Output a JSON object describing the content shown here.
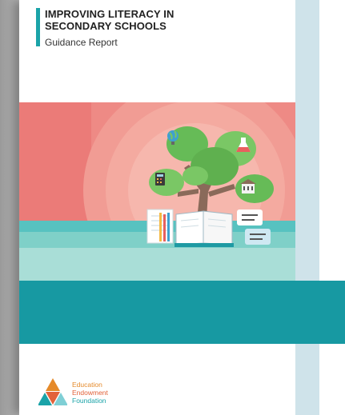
{
  "report": {
    "title_line1": "IMPROVING LITERACY IN",
    "title_line2": "SECONDARY SCHOOLS",
    "subtitle": "Guidance Report"
  },
  "organization": {
    "line1": "Education",
    "line2": "Endowment",
    "line3": "Foundation"
  },
  "colors": {
    "accent_teal": "#1799a2",
    "strip_blue": "#cfe3ea",
    "hero_salmon": "#ee8a85",
    "foliage_green": "#66bb57"
  },
  "illustration": {
    "icons": [
      "globe-icon",
      "flask-icon",
      "calculator-icon",
      "building-icon",
      "open-book-icon",
      "notebook-icon",
      "speech-bubble-icon"
    ]
  }
}
